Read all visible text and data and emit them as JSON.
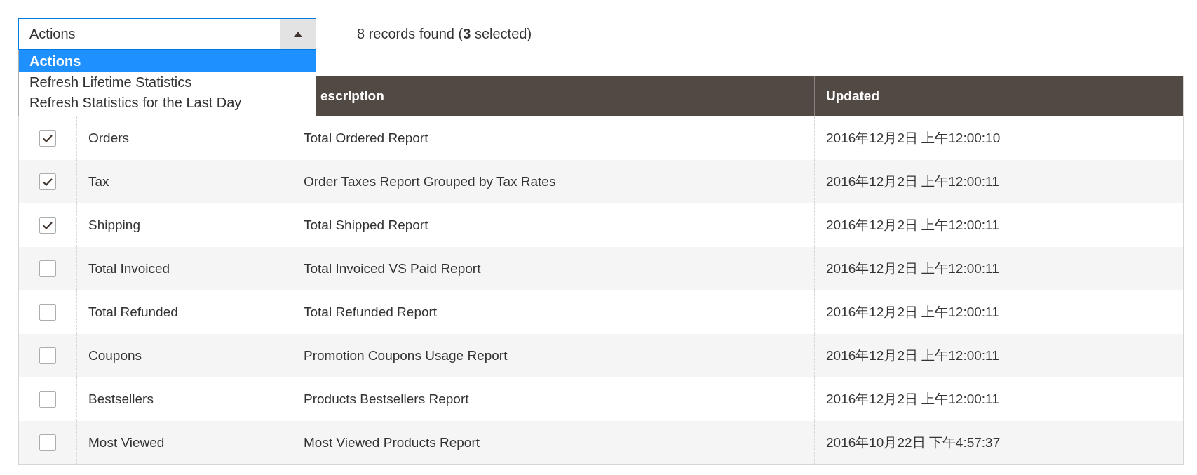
{
  "actions_select": {
    "value": "Actions",
    "expanded": true,
    "options": [
      {
        "label": "Actions",
        "selected": true
      },
      {
        "label": "Refresh Lifetime Statistics",
        "selected": false
      },
      {
        "label": "Refresh Statistics for the Last Day",
        "selected": false
      }
    ]
  },
  "records_summary": "8 records found (**3** selected)",
  "table": {
    "visible_headers": [
      "escription",
      "Updated"
    ],
    "rows": [
      {
        "checked": true,
        "report": "Orders",
        "description": "Total Ordered Report",
        "updated": "2016年12月2日 上午12:00:10"
      },
      {
        "checked": true,
        "report": "Tax",
        "description": "Order Taxes Report Grouped by Tax Rates",
        "updated": "2016年12月2日 上午12:00:11"
      },
      {
        "checked": true,
        "report": "Shipping",
        "description": "Total Shipped Report",
        "updated": "2016年12月2日 上午12:00:11"
      },
      {
        "checked": false,
        "report": "Total Invoiced",
        "description": "Total Invoiced VS Paid Report",
        "updated": "2016年12月2日 上午12:00:11"
      },
      {
        "checked": false,
        "report": "Total Refunded",
        "description": "Total Refunded Report",
        "updated": "2016年12月2日 上午12:00:11"
      },
      {
        "checked": false,
        "report": "Coupons",
        "description": "Promotion Coupons Usage Report",
        "updated": "2016年12月2日 上午12:00:11"
      },
      {
        "checked": false,
        "report": "Bestsellers",
        "description": "Products Bestsellers Report",
        "updated": "2016年12月2日 上午12:00:11"
      },
      {
        "checked": false,
        "report": "Most Viewed",
        "description": "Most Viewed Products Report",
        "updated": "2016年10月22日 下午4:57:37"
      }
    ]
  }
}
